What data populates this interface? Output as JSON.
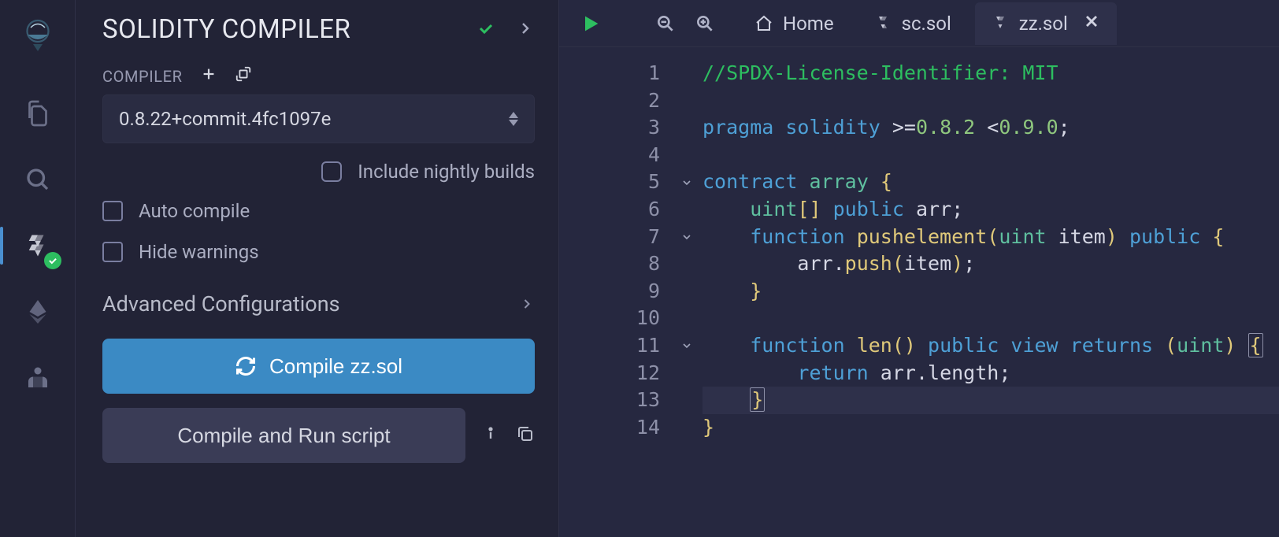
{
  "panel": {
    "title": "SOLIDITY COMPILER",
    "compiler_label": "COMPILER",
    "compiler_version": "0.8.22+commit.4fc1097e",
    "nightly_label": "Include nightly builds",
    "autocompile_label": "Auto compile",
    "hidewarn_label": "Hide warnings",
    "advanced_label": "Advanced Configurations",
    "compile_btn": "Compile zz.sol",
    "compile_run_btn": "Compile and Run script"
  },
  "tabs": {
    "home": "Home",
    "sc": "sc.sol",
    "zz": "zz.sol"
  },
  "code": {
    "lines": [
      {
        "n": 1,
        "fold": "",
        "html": "<span class='c-comment'>//SPDX-License-Identifier: MIT</span>"
      },
      {
        "n": 2,
        "fold": "",
        "html": ""
      },
      {
        "n": 3,
        "fold": "",
        "html": "<span class='c-key'>pragma</span> <span class='c-key'>solidity</span> <span class='c-op'>&gt;=</span><span class='c-num'>0.8.2</span> <span class='c-op'>&lt;</span><span class='c-num'>0.9.0</span><span class='c-op'>;</span>"
      },
      {
        "n": 4,
        "fold": "",
        "html": ""
      },
      {
        "n": 5,
        "fold": "v",
        "html": "<span class='c-key'>contract</span> <span class='c-type'>array</span> <span class='c-brace'>{</span>"
      },
      {
        "n": 6,
        "fold": "",
        "html": "    <span class='c-type'>uint</span><span class='c-brace'>[]</span> <span class='c-key'>public</span> <span class='c-ident'>arr</span><span class='c-op'>;</span>"
      },
      {
        "n": 7,
        "fold": "v",
        "html": "    <span class='c-key'>function</span> <span class='c-func'>pushelement</span><span class='c-brace'>(</span><span class='c-type'>uint</span> <span class='c-ident'>item</span><span class='c-brace'>)</span> <span class='c-key'>public</span> <span class='c-brace'>{</span>"
      },
      {
        "n": 8,
        "fold": "",
        "html": "        <span class='c-ident'>arr</span><span class='c-op'>.</span><span class='c-func'>push</span><span class='c-brace'>(</span><span class='c-ident'>item</span><span class='c-brace'>)</span><span class='c-op'>;</span>"
      },
      {
        "n": 9,
        "fold": "",
        "html": "    <span class='c-brace'>}</span>"
      },
      {
        "n": 10,
        "fold": "",
        "html": ""
      },
      {
        "n": 11,
        "fold": "v",
        "html": "    <span class='c-key'>function</span> <span class='c-func'>len</span><span class='c-brace'>()</span> <span class='c-key'>public</span> <span class='c-key'>view</span> <span class='c-key'>returns</span> <span class='c-brace'>(</span><span class='c-type'>uint</span><span class='c-brace'>)</span> <span class='c-brace bracket-hl'>{</span>"
      },
      {
        "n": 12,
        "fold": "",
        "html": "        <span class='c-key'>return</span> <span class='c-ident'>arr</span><span class='c-op'>.</span><span class='c-ident'>length</span><span class='c-op'>;</span>"
      },
      {
        "n": 13,
        "fold": "",
        "current": true,
        "html": "    <span class='c-brace bracket-hl'>}</span>"
      },
      {
        "n": 14,
        "fold": "",
        "html": "<span class='c-brace'>}</span>"
      }
    ]
  }
}
